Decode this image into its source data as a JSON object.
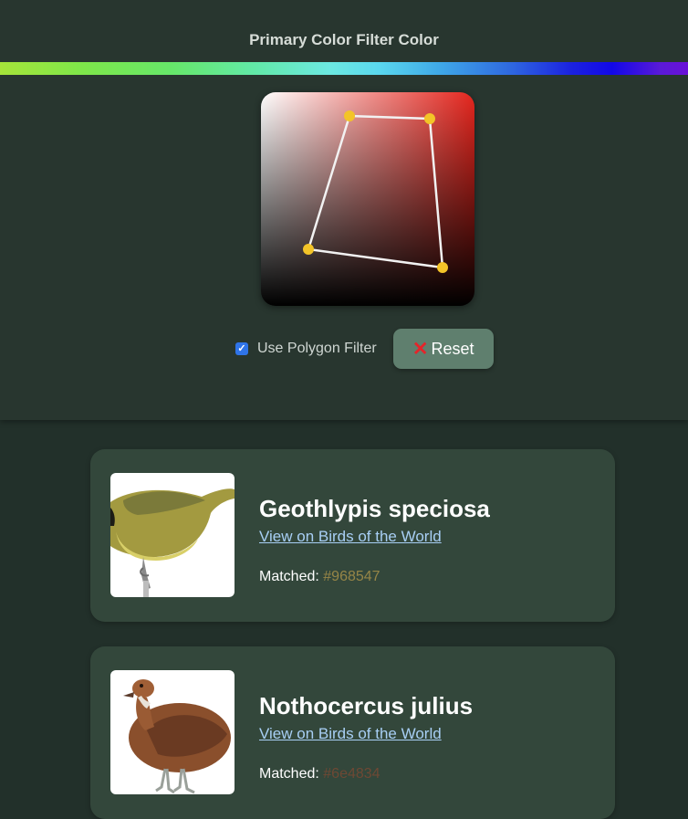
{
  "filter": {
    "title": "Primary Color Filter Color",
    "hue_strip_colors": [
      "#a6e43a",
      "#6ce9e2",
      "#1208e8",
      "#6a10d8"
    ],
    "picker_hue_color": "#e5261e",
    "handle_color": "#f3c428",
    "use_polygon_label": "Use Polygon Filter",
    "use_polygon_checked": true,
    "reset_icon": "close-icon",
    "reset_glyph": "✕",
    "reset_label": "Reset"
  },
  "results": [
    {
      "species": "Geothlypis speciosa",
      "link_text": "View on Birds of the World",
      "matched_label": "Matched:",
      "matched_color": "#968547"
    },
    {
      "species": "Nothocercus julius",
      "link_text": "View on Birds of the World",
      "matched_label": "Matched:",
      "matched_color": "#6e4834"
    }
  ]
}
